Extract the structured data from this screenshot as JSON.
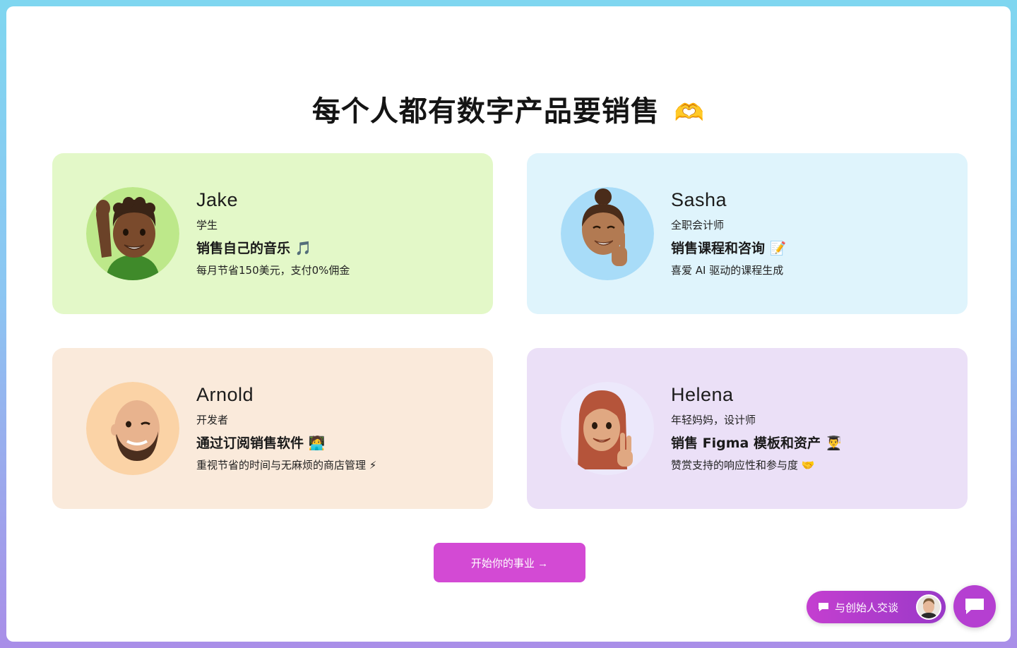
{
  "headline": {
    "text": "每个人都有数字产品要销售",
    "emoji": "🫶"
  },
  "cards": [
    {
      "name": "Jake",
      "role": "学生",
      "what": "销售自己的音乐 🎵",
      "why": "每月节省150美元，支付0%佣金",
      "bg": "#e3f8c8",
      "avatar_bg": "#bde88a",
      "avatar_icon": "memoji-waving-boy-icon"
    },
    {
      "name": "Sasha",
      "role": "全职会计师",
      "what": "销售课程和咨询 📝",
      "why": "喜爱 AI 驱动的课程生成",
      "bg": "#dff4fc",
      "avatar_bg": "#a8dcf8",
      "avatar_icon": "memoji-peace-girl-icon"
    },
    {
      "name": "Arnold",
      "role": "开发者",
      "what": "通过订阅销售软件 🧑‍💻",
      "why": "重视节省的时间与无麻烦的商店管理 ⚡",
      "bg": "#faeadb",
      "avatar_bg": "#fbd3a6",
      "avatar_icon": "memoji-winking-man-icon"
    },
    {
      "name": "Helena",
      "role": "年轻妈妈，设计师",
      "what": "销售 Figma 模板和资产 👨‍🎓",
      "why": "赞赏支持的响应性和参与度 🤝",
      "bg": "#ebe0f7",
      "avatar_bg": "#ece8fb",
      "avatar_icon": "memoji-redhead-woman-icon"
    }
  ],
  "cta": {
    "label": "开始你的事业 →",
    "color": "#d34ad4"
  },
  "chat": {
    "pill_label": "与创始人交谈",
    "pill_icon": "chat-bubble-icon",
    "fab_icon": "chat-bubble-icon",
    "accent": "#b53fd1"
  }
}
